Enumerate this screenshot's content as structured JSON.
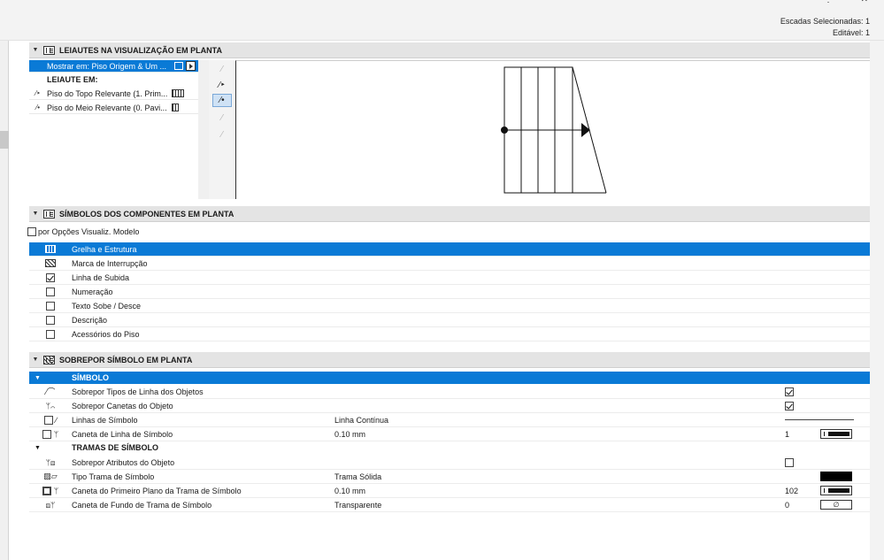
{
  "topbar": {
    "status_selected": "Escadas Selecionadas: 1",
    "status_editable": "Editável: 1",
    "more_icon": "⋮",
    "close_icon": "✕"
  },
  "section_layouts": {
    "title": "LEIAUTES NA VISUALIZAÇÃO EM PLANTA",
    "show_in": "Mostrar em: Piso Origem & Um ...",
    "layout_heading": "LEIAUTE EM:",
    "items": [
      {
        "glyph": "⁄‣",
        "label": "Piso do Topo Relevante (1. Prim..."
      },
      {
        "glyph": "⁄•",
        "label": "Piso do Meio Relevante (0. Pavi..."
      }
    ],
    "tools": [
      "⁄",
      "⁄‣",
      "⁄•",
      "⁄",
      "⁄"
    ]
  },
  "section_symbols": {
    "title": "SÍMBOLOS DOS COMPONENTES EM PLANTA",
    "by_model_view": "por Opções Visualiz. Modelo",
    "rows": [
      {
        "label": "Grelha e Estrutura",
        "checked": false
      },
      {
        "label": "Marca de Interrupção",
        "checked": false
      },
      {
        "label": "Linha de Subida",
        "checked": true
      },
      {
        "label": "Numeração",
        "checked": false
      },
      {
        "label": "Texto Sobe / Desce",
        "checked": false
      },
      {
        "label": "Descrição",
        "checked": false
      },
      {
        "label": "Acessórios do Piso",
        "checked": false
      }
    ]
  },
  "section_override": {
    "title": "SOBREPOR SÍMBOLO EM PLANTA",
    "group_symbol": "SÍMBOLO",
    "override_line_types": "Sobrepor Tipos de Linha dos Objetos",
    "override_pens": "Sobrepor Canetas do Objeto",
    "symbol_lines": "Linhas de Símbolo",
    "symbol_lines_value": "Linha Contínua",
    "symbol_line_pen": "Caneta de Linha de Símbolo",
    "symbol_line_pen_value": "0.10 mm",
    "symbol_line_pen_num": "1",
    "group_fills": "TRAMAS DE SÍMBOLO",
    "override_attrs": "Sobrepor Atributos do Objeto",
    "fill_type": "Tipo Trama de Símbolo",
    "fill_type_value": "Trama Sólida",
    "fg_pen": "Caneta do Primeiro Plano da Trama de Símbolo",
    "fg_pen_value": "0.10 mm",
    "fg_pen_num": "102",
    "bg_pen": "Caneta de Fundo de Trama de Símbolo",
    "bg_pen_value": "Transparente",
    "bg_pen_num": "0",
    "bg_pen_symbol": "∅"
  }
}
